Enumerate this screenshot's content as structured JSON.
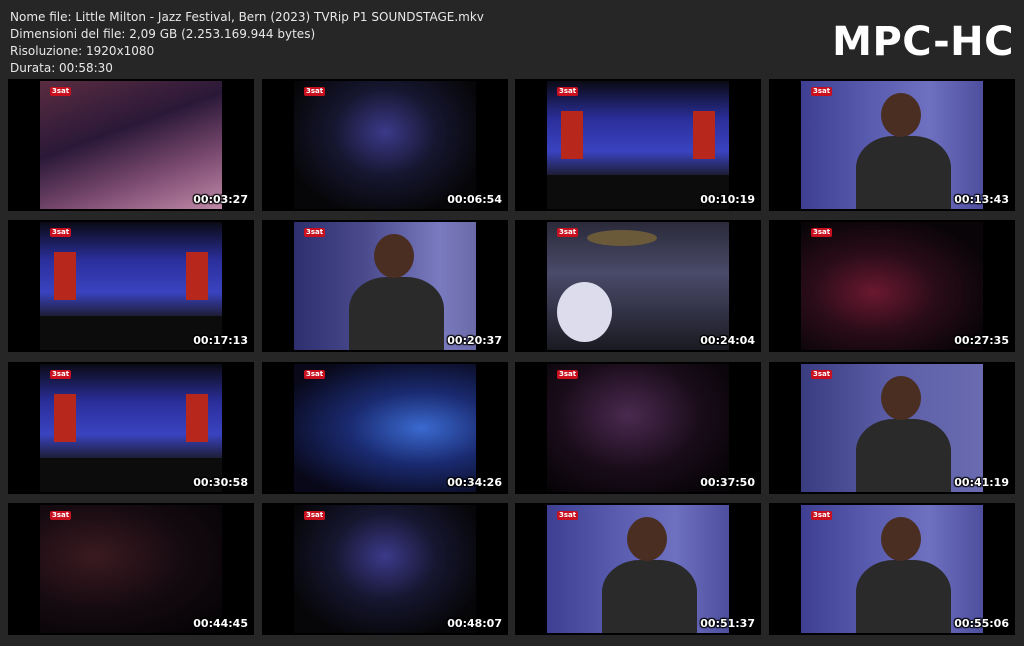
{
  "file_info": {
    "name": "Nome file: Little Milton - Jazz Festival, Bern (2023) TVRip P1 SOUNDSTAGE.mkv",
    "size": "Dimensioni del file: 2,09 GB (2.253.169.944 bytes)",
    "resolution": "Risoluzione: 1920x1080",
    "duration": "Durata: 00:58:30"
  },
  "brand": "MPC-HC",
  "thumbnails": [
    {
      "time": "00:03:27",
      "scene": "keyboard-closeup",
      "logo": "3sat"
    },
    {
      "time": "00:06:54",
      "scene": "club-wide-dark",
      "logo": "3sat"
    },
    {
      "time": "00:10:19",
      "scene": "stage-wide-blue",
      "logo": "3sat"
    },
    {
      "time": "00:13:43",
      "scene": "singer-closeup",
      "logo": "3sat"
    },
    {
      "time": "00:17:13",
      "scene": "stage-wide-blue",
      "logo": "3sat"
    },
    {
      "time": "00:20:37",
      "scene": "guitarist-closeup",
      "logo": "3sat"
    },
    {
      "time": "00:24:04",
      "scene": "drummer",
      "logo": "3sat"
    },
    {
      "time": "00:27:35",
      "scene": "club-wide-red",
      "logo": "3sat"
    },
    {
      "time": "00:30:58",
      "scene": "stage-wide-blue",
      "logo": "3sat"
    },
    {
      "time": "00:34:26",
      "scene": "keyboard-player",
      "logo": "3sat"
    },
    {
      "time": "00:37:50",
      "scene": "guitarist-dark",
      "logo": "3sat"
    },
    {
      "time": "00:41:19",
      "scene": "singer-guitar",
      "logo": "3sat"
    },
    {
      "time": "00:44:45",
      "scene": "guitarist-stage-light",
      "logo": "3sat"
    },
    {
      "time": "00:48:07",
      "scene": "club-wide-dark",
      "logo": "3sat"
    },
    {
      "time": "00:51:37",
      "scene": "singer-closeup",
      "logo": "3sat"
    },
    {
      "time": "00:55:06",
      "scene": "singer-closeup",
      "logo": "3sat"
    }
  ],
  "colors": {
    "background": "#262626",
    "tile_bg": "#000000",
    "text": "#e8e8e8",
    "stage_blue": "#3a3ab0",
    "banner_red": "#b8271c"
  }
}
